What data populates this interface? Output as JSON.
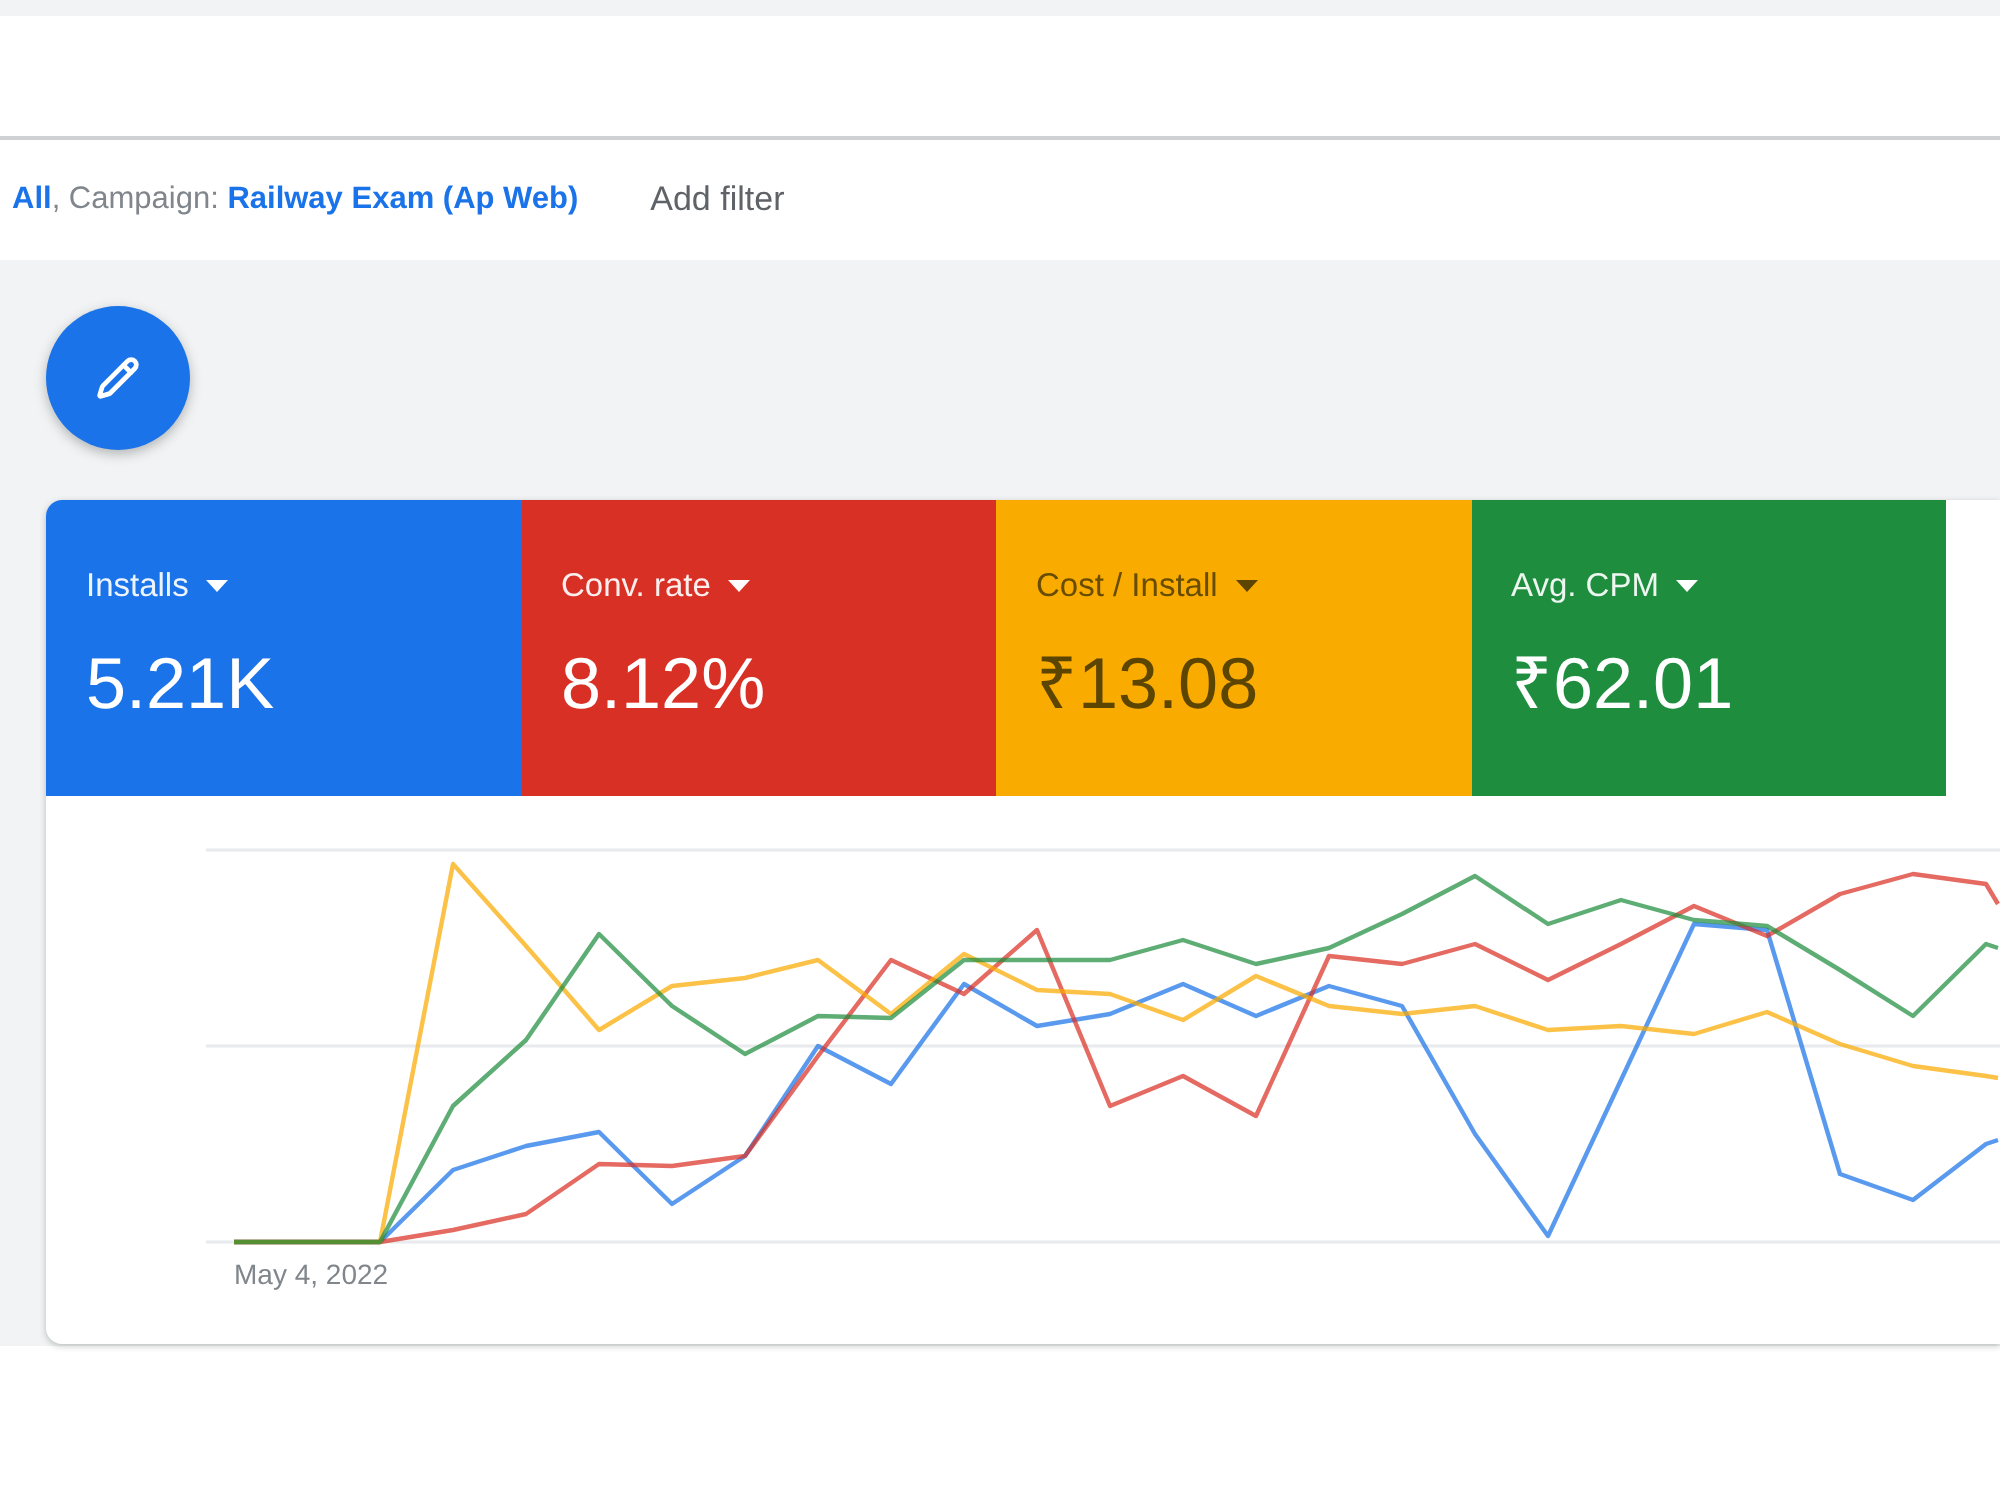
{
  "filter_bar": {
    "filter": "**All**, Campaign: **Railway Exam (Ap Web)**",
    "add_filter": "Add filter"
  },
  "metrics": [
    {
      "label": "Installs",
      "value": "5.21K",
      "color": "#1a73e8",
      "selected": true
    },
    {
      "label": "Conv. rate",
      "value": "8.12%",
      "color": "#d93025",
      "selected": true
    },
    {
      "label": "Cost / Install",
      "value": "₹13.08",
      "color": "#f9ab00",
      "selected": true
    },
    {
      "label": "Avg. CPM",
      "value": "₹62.01",
      "color": "#1e8e3e",
      "selected": true
    }
  ],
  "chart": {
    "x_label": "May 4, 2022"
  }
}
